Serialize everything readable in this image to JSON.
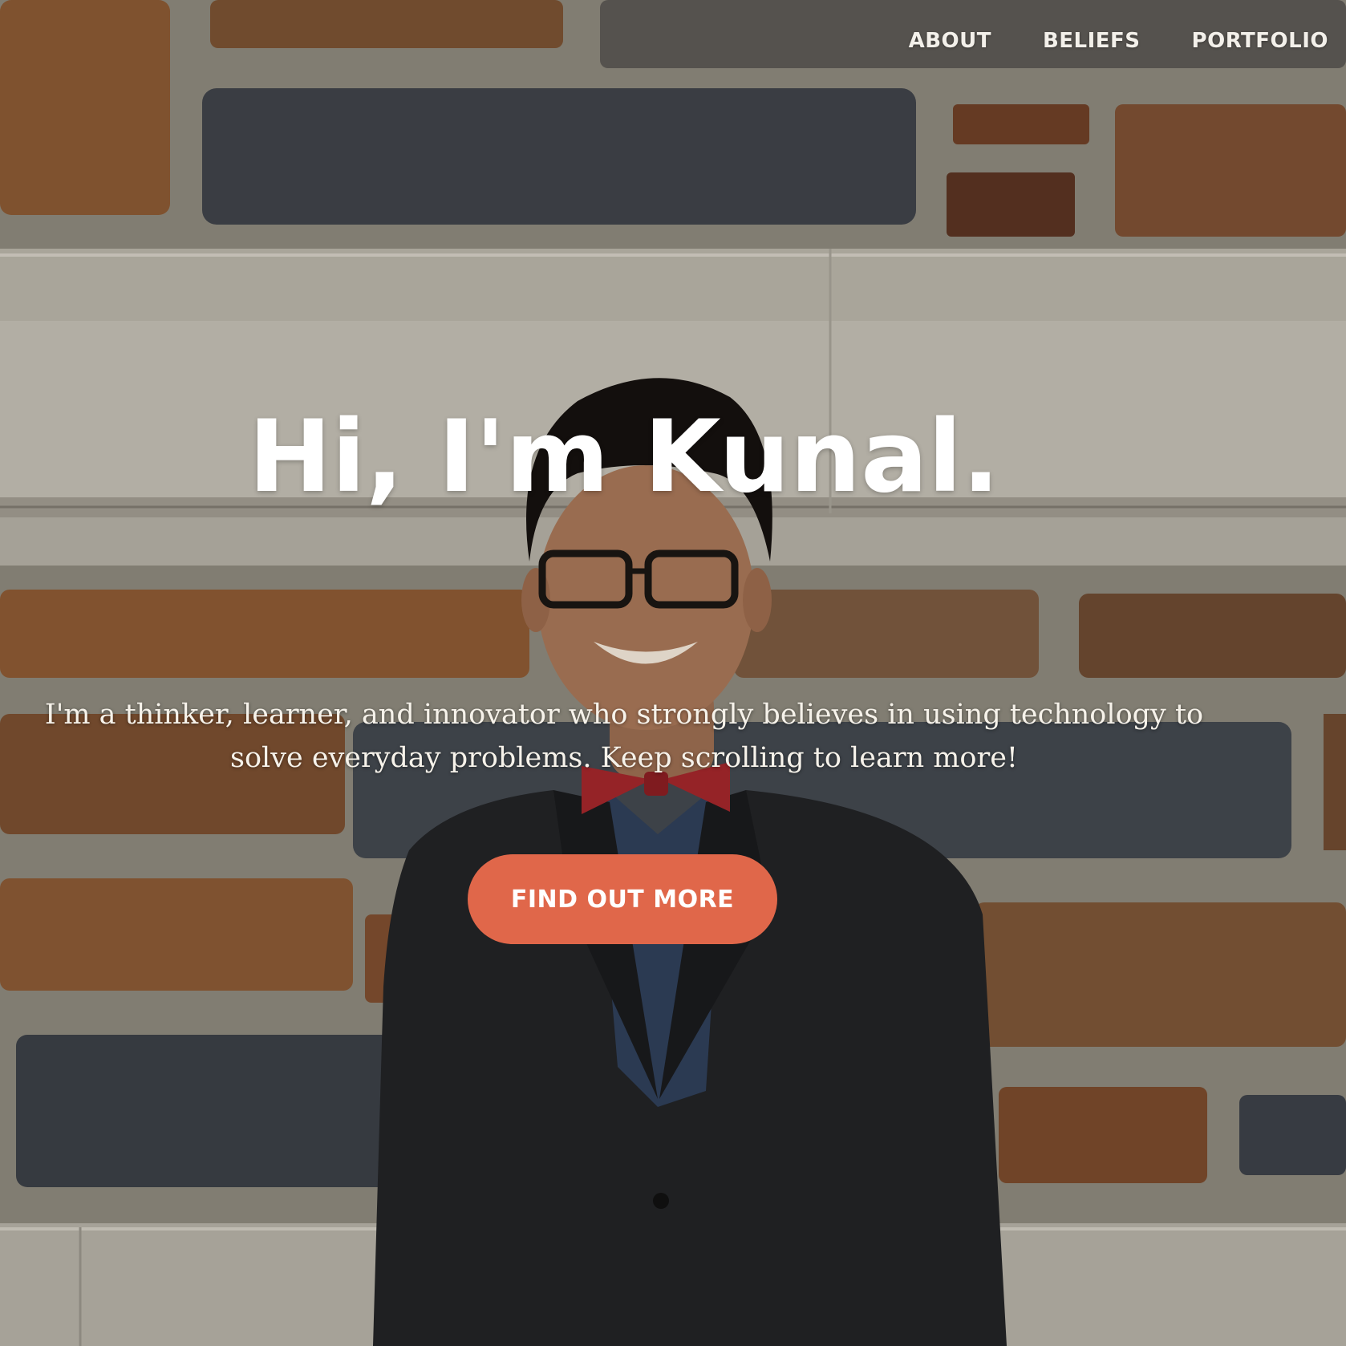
{
  "nav": {
    "items": [
      {
        "label": "ABOUT"
      },
      {
        "label": "BELIEFS"
      },
      {
        "label": "PORTFOLIO"
      }
    ]
  },
  "hero": {
    "headline": "Hi, I'm Kunal.",
    "subtitle": "I'm a thinker, learner, and innovator who strongly believes in using technology to solve everyday problems. Keep scrolling to learn more!",
    "cta_label": "FIND OUT MORE"
  },
  "colors": {
    "accent": "#e0674a",
    "text": "#ffffff"
  }
}
